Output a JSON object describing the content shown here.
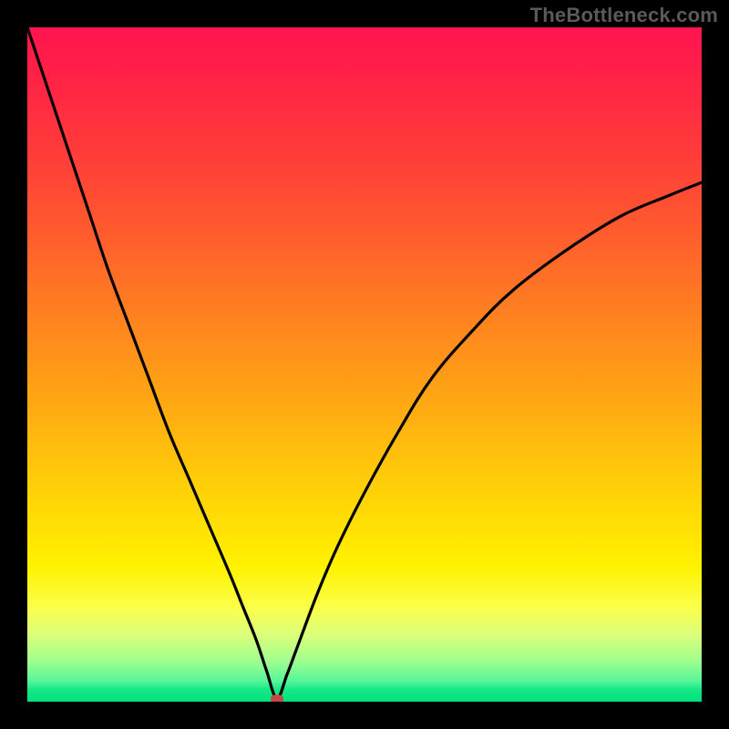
{
  "watermark": "TheBottleneck.com",
  "chart_data": {
    "type": "line",
    "title": "",
    "xlabel": "",
    "ylabel": "",
    "xlim": [
      0,
      100
    ],
    "ylim": [
      0,
      100
    ],
    "grid": false,
    "legend": false,
    "minimum_marker": {
      "x": 37,
      "y": 0
    },
    "series": [
      {
        "name": "curve",
        "x": [
          0,
          3,
          6,
          9,
          12,
          15,
          18,
          21,
          24,
          27,
          30,
          32,
          34,
          35.5,
          37,
          38.5,
          40,
          43,
          46,
          50,
          55,
          60,
          66,
          72,
          80,
          88,
          95,
          100
        ],
        "y": [
          100,
          91,
          82,
          73,
          64,
          56,
          48,
          40,
          33,
          26,
          19,
          14,
          9,
          4.5,
          0.5,
          4,
          8,
          16,
          23,
          31,
          40,
          48,
          55,
          61,
          67,
          72,
          75,
          77
        ]
      }
    ],
    "colors": {
      "curve": "#000000",
      "marker": "#c24a42",
      "gradient_top": "#ff1450",
      "gradient_bottom": "#00e17e"
    }
  }
}
